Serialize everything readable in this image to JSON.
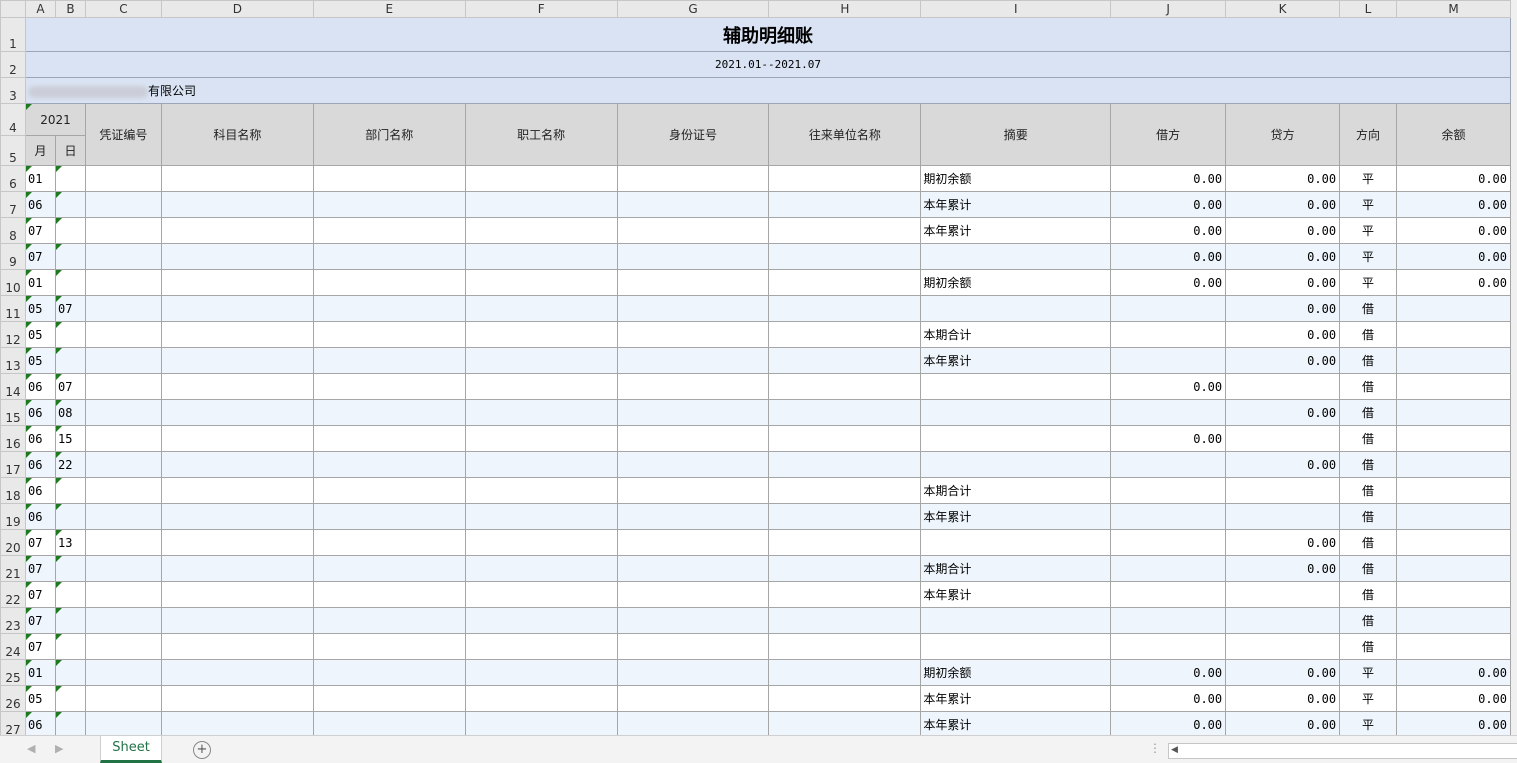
{
  "columns": [
    "A",
    "B",
    "C",
    "D",
    "E",
    "F",
    "G",
    "H",
    "I",
    "J",
    "K",
    "L",
    "M"
  ],
  "title": "辅助明细账",
  "date_range": "2021.01--2021.07",
  "company_suffix": "有限公司",
  "headers": {
    "year": "2021",
    "month": "月",
    "day": "日",
    "voucher_no": "凭证编号",
    "account_name": "科目名称",
    "dept_name": "部门名称",
    "employee_name": "职工名称",
    "id_no": "身份证号",
    "counterparty": "往来单位名称",
    "summary": "摘要",
    "debit": "借方",
    "credit": "贷方",
    "direction": "方向",
    "balance": "余额"
  },
  "rows": [
    {
      "rn": "6",
      "m": "01",
      "d": "",
      "v": "",
      "acct": "",
      "dept": "",
      "emp": "",
      "cp": "",
      "sum": "期初余额",
      "dr": "0.00",
      "cr": "0.00",
      "dir": "平",
      "bal": "0.00"
    },
    {
      "rn": "7",
      "m": "06",
      "d": "",
      "v": "",
      "acct": "",
      "dept": "",
      "emp": "",
      "cp": "",
      "sum": "本年累计",
      "dr": "0.00",
      "cr": "0.00",
      "dir": "平",
      "bal": "0.00"
    },
    {
      "rn": "8",
      "m": "07",
      "d": "",
      "v": "",
      "acct": "",
      "dept": "",
      "emp": "",
      "cp": "",
      "sum": "本年累计",
      "dr": "0.00",
      "cr": "0.00",
      "dir": "平",
      "bal": "0.00"
    },
    {
      "rn": "9",
      "m": "07",
      "d": "",
      "v": "",
      "acct": "",
      "dept": "",
      "emp": "",
      "cp": "",
      "sum": "",
      "dr": "0.00",
      "cr": "0.00",
      "dir": "平",
      "bal": "0.00"
    },
    {
      "rn": "10",
      "m": "01",
      "d": "",
      "v": "",
      "acct": "",
      "dept": "",
      "emp": "",
      "cp": "",
      "sum": "期初余额",
      "dr": "0.00",
      "cr": "0.00",
      "dir": "平",
      "bal": "0.00"
    },
    {
      "rn": "11",
      "m": "05",
      "d": "07",
      "v": "",
      "acct": "",
      "dept": "",
      "emp": "",
      "cp": "",
      "sum": "",
      "dr": "",
      "cr": "0.00",
      "dir": "借",
      "bal": ""
    },
    {
      "rn": "12",
      "m": "05",
      "d": "",
      "v": "",
      "acct": "",
      "dept": "",
      "emp": "",
      "cp": "",
      "sum": "本期合计",
      "dr": "",
      "cr": "0.00",
      "dir": "借",
      "bal": ""
    },
    {
      "rn": "13",
      "m": "05",
      "d": "",
      "v": "",
      "acct": "",
      "dept": "",
      "emp": "",
      "cp": "",
      "sum": "本年累计",
      "dr": "",
      "cr": "0.00",
      "dir": "借",
      "bal": ""
    },
    {
      "rn": "14",
      "m": "06",
      "d": "07",
      "v": "",
      "acct": "",
      "dept": "",
      "emp": "",
      "cp": "",
      "sum": "",
      "dr": "0.00",
      "cr": "",
      "dir": "借",
      "bal": ""
    },
    {
      "rn": "15",
      "m": "06",
      "d": "08",
      "v": "",
      "acct": "",
      "dept": "",
      "emp": "",
      "cp": "",
      "sum": "",
      "dr": "",
      "cr": "0.00",
      "dir": "借",
      "bal": ""
    },
    {
      "rn": "16",
      "m": "06",
      "d": "15",
      "v": "",
      "acct": "",
      "dept": "",
      "emp": "",
      "cp": "",
      "sum": "",
      "dr": "0.00",
      "cr": "",
      "dir": "借",
      "bal": ""
    },
    {
      "rn": "17",
      "m": "06",
      "d": "22",
      "v": "",
      "acct": "",
      "dept": "",
      "emp": "",
      "cp": "",
      "sum": "",
      "dr": "",
      "cr": "0.00",
      "dir": "借",
      "bal": ""
    },
    {
      "rn": "18",
      "m": "06",
      "d": "",
      "v": "",
      "acct": "",
      "dept": "",
      "emp": "",
      "cp": "",
      "sum": "本期合计",
      "dr": "",
      "cr": "",
      "dir": "借",
      "bal": ""
    },
    {
      "rn": "19",
      "m": "06",
      "d": "",
      "v": "",
      "acct": "",
      "dept": "",
      "emp": "",
      "cp": "",
      "sum": "本年累计",
      "dr": "",
      "cr": "",
      "dir": "借",
      "bal": ""
    },
    {
      "rn": "20",
      "m": "07",
      "d": "13",
      "v": "",
      "acct": "",
      "dept": "",
      "emp": "",
      "cp": "",
      "sum": "",
      "dr": "",
      "cr": "0.00",
      "dir": "借",
      "bal": ""
    },
    {
      "rn": "21",
      "m": "07",
      "d": "",
      "v": "",
      "acct": "",
      "dept": "",
      "emp": "",
      "cp": "",
      "sum": "本期合计",
      "dr": "",
      "cr": "0.00",
      "dir": "借",
      "bal": ""
    },
    {
      "rn": "22",
      "m": "07",
      "d": "",
      "v": "",
      "acct": "",
      "dept": "",
      "emp": "",
      "cp": "",
      "sum": "本年累计",
      "dr": "",
      "cr": "",
      "dir": "借",
      "bal": ""
    },
    {
      "rn": "23",
      "m": "07",
      "d": "",
      "v": "",
      "acct": "",
      "dept": "",
      "emp": "",
      "cp": "",
      "sum": "",
      "dr": "",
      "cr": "",
      "dir": "借",
      "bal": ""
    },
    {
      "rn": "24",
      "m": "07",
      "d": "",
      "v": "",
      "acct": "",
      "dept": "",
      "emp": "",
      "cp": "",
      "sum": "",
      "dr": "",
      "cr": "",
      "dir": "借",
      "bal": ""
    },
    {
      "rn": "25",
      "m": "01",
      "d": "",
      "v": "",
      "acct": "",
      "dept": "",
      "emp": "",
      "cp": "",
      "sum": "期初余额",
      "dr": "0.00",
      "cr": "0.00",
      "dir": "平",
      "bal": "0.00"
    },
    {
      "rn": "26",
      "m": "05",
      "d": "",
      "v": "",
      "acct": "",
      "dept": "",
      "emp": "",
      "cp": "",
      "sum": "本年累计",
      "dr": "0.00",
      "cr": "0.00",
      "dir": "平",
      "bal": "0.00"
    },
    {
      "rn": "27",
      "m": "06",
      "d": "",
      "v": "",
      "acct": "",
      "dept": "",
      "emp": "",
      "cp": "",
      "sum": "本年累计",
      "dr": "0.00",
      "cr": "0.00",
      "dir": "平",
      "bal": "0.00"
    }
  ],
  "sheet_tab": "Sheet",
  "add_sheet": "+",
  "colors": {
    "title_bg": "#dae3f3",
    "header_bg": "#d9d9d9",
    "alt_row_bg": "#eef5fc",
    "accent": "#217346"
  }
}
